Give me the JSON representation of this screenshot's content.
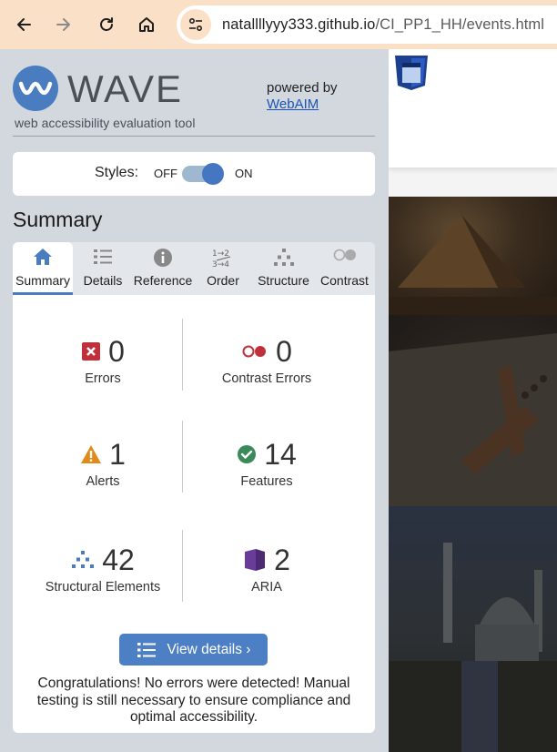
{
  "browser": {
    "url_host": "natallllyyy333.github.io",
    "url_path": "/CI_PP1_HH/events.html"
  },
  "wave": {
    "logo_text": "WAVE",
    "tagline": "web accessibility evaluation tool",
    "powered_by": "powered by",
    "powered_link": "WebAIM",
    "styles_label": "Styles:",
    "styles_off": "OFF",
    "styles_on": "ON",
    "styles_toggle_on": true,
    "summary_heading": "Summary",
    "tabs": [
      {
        "label": "Summary",
        "icon": "home-icon",
        "active": true
      },
      {
        "label": "Details",
        "icon": "list-icon",
        "active": false
      },
      {
        "label": "Reference",
        "icon": "info-icon",
        "active": false
      },
      {
        "label": "Order",
        "icon": "order-icon",
        "active": false
      },
      {
        "label": "Structure",
        "icon": "structure-icon",
        "active": false
      },
      {
        "label": "Contrast",
        "icon": "contrast-icon",
        "active": false
      }
    ],
    "stats": {
      "errors": {
        "value": "0",
        "label": "Errors"
      },
      "contrast_errors": {
        "value": "0",
        "label": "Contrast Errors"
      },
      "alerts": {
        "value": "1",
        "label": "Alerts"
      },
      "features": {
        "value": "14",
        "label": "Features"
      },
      "structural": {
        "value": "42",
        "label": "Structural Elements"
      },
      "aria": {
        "value": "2",
        "label": "ARIA"
      }
    },
    "view_details": "View details ›",
    "congrats": "Congratulations! No errors were detected! Manual testing is still necessary to ensure compliance and optimal accessibility.",
    "colors": {
      "accent": "#4a7dc0",
      "error": "#c0303a",
      "alert": "#e08a1a",
      "feature": "#3a8a5a",
      "aria": "#6a3c9a"
    }
  }
}
